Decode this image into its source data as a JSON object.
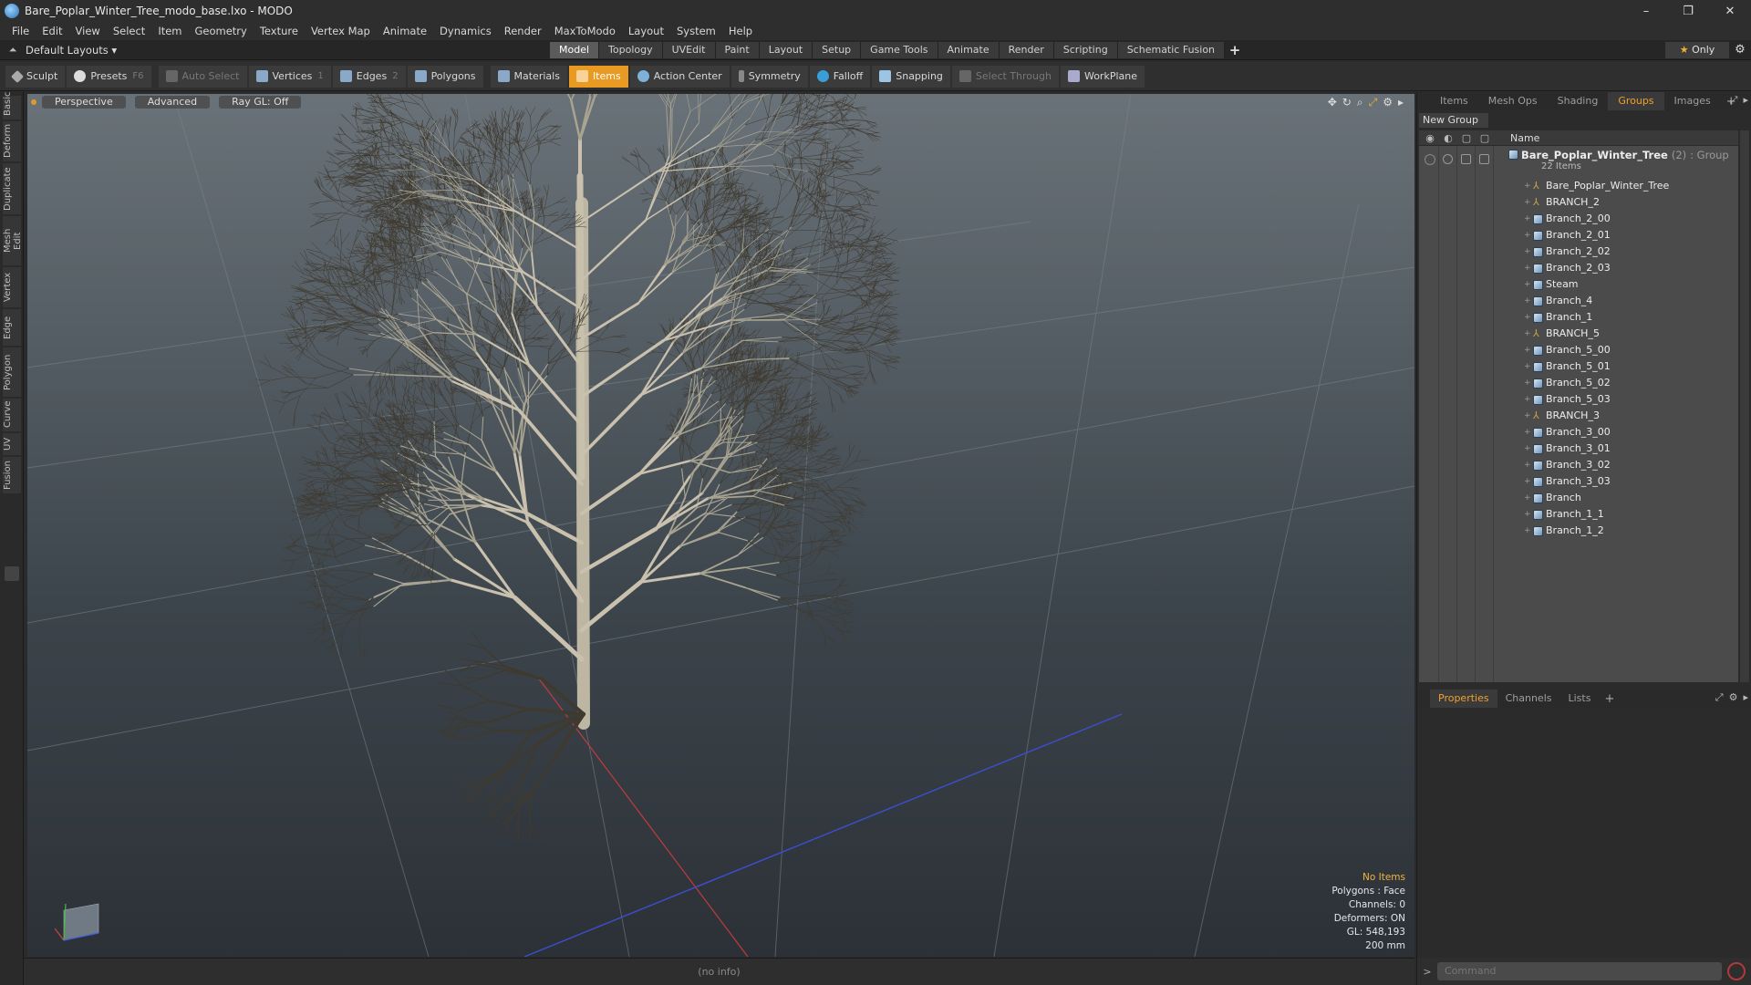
{
  "window": {
    "title": "Bare_Poplar_Winter_Tree_modo_base.lxo - MODO",
    "controls": [
      "–",
      "❐",
      "✕"
    ]
  },
  "menu": [
    "File",
    "Edit",
    "View",
    "Select",
    "Item",
    "Geometry",
    "Texture",
    "Vertex Map",
    "Animate",
    "Dynamics",
    "Render",
    "MaxToModo",
    "Layout",
    "System",
    "Help"
  ],
  "layoutbar": {
    "layout_select": "Default Layouts ▾",
    "tabs": [
      "Model",
      "Topology",
      "UVEdit",
      "Paint",
      "Layout",
      "Setup",
      "Game Tools",
      "Animate",
      "Render",
      "Scripting",
      "Schematic Fusion"
    ],
    "active_tab": "Model",
    "only_label": "Only"
  },
  "toolbar": {
    "sculpt": "Sculpt",
    "presets": "Presets",
    "presets_key": "F6",
    "auto_select": "Auto Select",
    "vertices": "Vertices",
    "vertices_key": "1",
    "edges": "Edges",
    "edges_key": "2",
    "polygons": "Polygons",
    "materials": "Materials",
    "items": "Items",
    "action_center": "Action Center",
    "symmetry": "Symmetry",
    "falloff": "Falloff",
    "snapping": "Snapping",
    "select_through": "Select Through",
    "workplane": "WorkPlane"
  },
  "left_tabs": [
    "Basic",
    "Deform",
    "Duplicate",
    "Mesh Edit",
    "Vertex",
    "Edge",
    "Polygon",
    "Curve",
    "UV",
    "Fusion"
  ],
  "viewport": {
    "view": "Perspective",
    "shading": "Advanced",
    "raygl": "Ray GL: Off",
    "info": {
      "selection": "No Items",
      "polygons": "Polygons : Face",
      "channels": "Channels: 0",
      "deformers": "Deformers: ON",
      "gl": "GL: 548,193",
      "unit": "200 mm"
    }
  },
  "status": "(no info)",
  "right_panel": {
    "tabs": [
      "Items",
      "Mesh Ops",
      "Shading",
      "Groups",
      "Images"
    ],
    "active_tab": "Groups",
    "new_group": "New Group",
    "col_name": "Name",
    "group": {
      "name": "Bare_Poplar_Winter_Tree",
      "count": "(2)",
      "type": ": Group",
      "sub": "22 Items"
    },
    "items": [
      {
        "label": "Bare_Poplar_Winter_Tree",
        "type": "locator"
      },
      {
        "label": "BRANCH_2",
        "type": "locator"
      },
      {
        "label": "Branch_2_00",
        "type": "mesh"
      },
      {
        "label": "Branch_2_01",
        "type": "mesh"
      },
      {
        "label": "Branch_2_02",
        "type": "mesh"
      },
      {
        "label": "Branch_2_03",
        "type": "mesh"
      },
      {
        "label": "Steam",
        "type": "mesh"
      },
      {
        "label": "Branch_4",
        "type": "mesh"
      },
      {
        "label": "Branch_1",
        "type": "mesh"
      },
      {
        "label": "BRANCH_5",
        "type": "locator"
      },
      {
        "label": "Branch_5_00",
        "type": "mesh"
      },
      {
        "label": "Branch_5_01",
        "type": "mesh"
      },
      {
        "label": "Branch_5_02",
        "type": "mesh"
      },
      {
        "label": "Branch_5_03",
        "type": "mesh"
      },
      {
        "label": "BRANCH_3",
        "type": "locator"
      },
      {
        "label": "Branch_3_00",
        "type": "mesh"
      },
      {
        "label": "Branch_3_01",
        "type": "mesh"
      },
      {
        "label": "Branch_3_02",
        "type": "mesh"
      },
      {
        "label": "Branch_3_03",
        "type": "mesh"
      },
      {
        "label": "Branch",
        "type": "mesh"
      },
      {
        "label": "Branch_1_1",
        "type": "mesh"
      },
      {
        "label": "Branch_1_2",
        "type": "mesh"
      }
    ],
    "bottom_tabs": [
      "Properties",
      "Channels",
      "Lists"
    ],
    "bottom_active": "Properties",
    "command_placeholder": "Command"
  },
  "colors": {
    "accent": "#e89a22",
    "tab_active_text": "#f0a030",
    "info_highlight": "#f2b43c"
  }
}
